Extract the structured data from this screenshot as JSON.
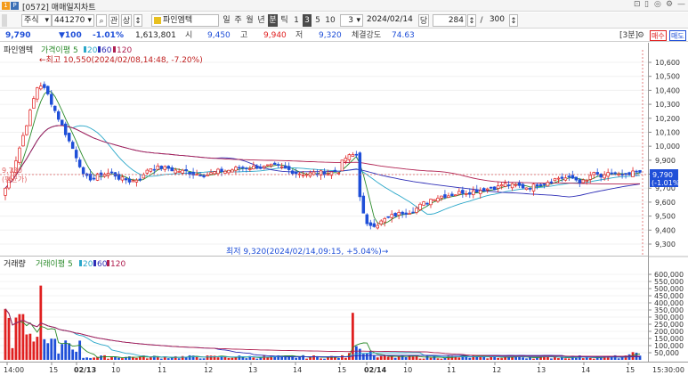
{
  "window": {
    "app_badge_1": "1",
    "app_badge_2": "P",
    "title": "[0572] 매매일지차트",
    "controls": [
      "⊡",
      "▯",
      "◎",
      "⚙",
      "—"
    ]
  },
  "toolbar": {
    "market": "주식",
    "code": "441270",
    "search_icon_label": "⌕",
    "btn_pan": "관",
    "btn_sang": "상",
    "stepper": "↕",
    "stock_name": "파인엠텍",
    "periods": [
      "일",
      "주",
      "월",
      "년",
      "분",
      "틱",
      "1",
      "3",
      "5",
      "10"
    ],
    "selected_period": "분",
    "selected_interval": "3",
    "interval_value": "3",
    "date": "2024/02/14",
    "date_toggle": "당",
    "count": "284",
    "slash": "/",
    "total": "300"
  },
  "infobar": {
    "price": "9,790",
    "change": "▼100",
    "change_pct": "-1.01%",
    "volume": "1,613,801",
    "open_label": "시",
    "open": "9,450",
    "high_label": "고",
    "high": "9,940",
    "low_label": "저",
    "low": "9,320",
    "strength_label": "체결강도",
    "strength": "74.63",
    "interval_label": "[3분]",
    "buy_label": "매수",
    "sell_label": "매도"
  },
  "price_chart": {
    "legend": {
      "name": "파인엠텍",
      "ma_title": "가격이평",
      "ma": [
        "5",
        "20",
        "60",
        "120"
      ]
    },
    "annotation_high": "←최고 10,550(2024/02/08,14:48, -7.20%)",
    "annotation_low": "최저 9,320(2024/02/14,09:15, +5.04%)→",
    "left_mark_top": "9,730",
    "left_mark_bottom": "(평균가)",
    "current_label": "9,790",
    "current_change": "(-1.01%)",
    "yaxis": [
      "10,600",
      "10,500",
      "10,400",
      "10,300",
      "10,200",
      "10,100",
      "10,000",
      "9,900",
      "9,800",
      "9,700",
      "9,600",
      "9,500",
      "9,400",
      "9,300"
    ]
  },
  "volume_chart": {
    "legend": {
      "name": "거래량",
      "ma_title": "거래이평",
      "ma": [
        "5",
        "20",
        "60",
        "120"
      ]
    },
    "yaxis": [
      "600,000",
      "550,000",
      "500,000",
      "450,000",
      "400,000",
      "350,000",
      "300,000",
      "250,000",
      "200,000",
      "150,000",
      "100,000",
      "50,000"
    ]
  },
  "xaxis": {
    "labels": [
      "14:00",
      "15",
      "02/13",
      "10",
      "11",
      "12",
      "13",
      "14",
      "15",
      "02/14",
      "10",
      "11",
      "12",
      "13",
      "14",
      "15"
    ],
    "time": "15:30:00"
  },
  "colors": {
    "up": "#e02020",
    "down": "#1f4fd8",
    "ma5": "#2a8a2a",
    "ma20": "#2aa7c9",
    "ma60": "#2d2db6",
    "ma120": "#b02050"
  }
}
